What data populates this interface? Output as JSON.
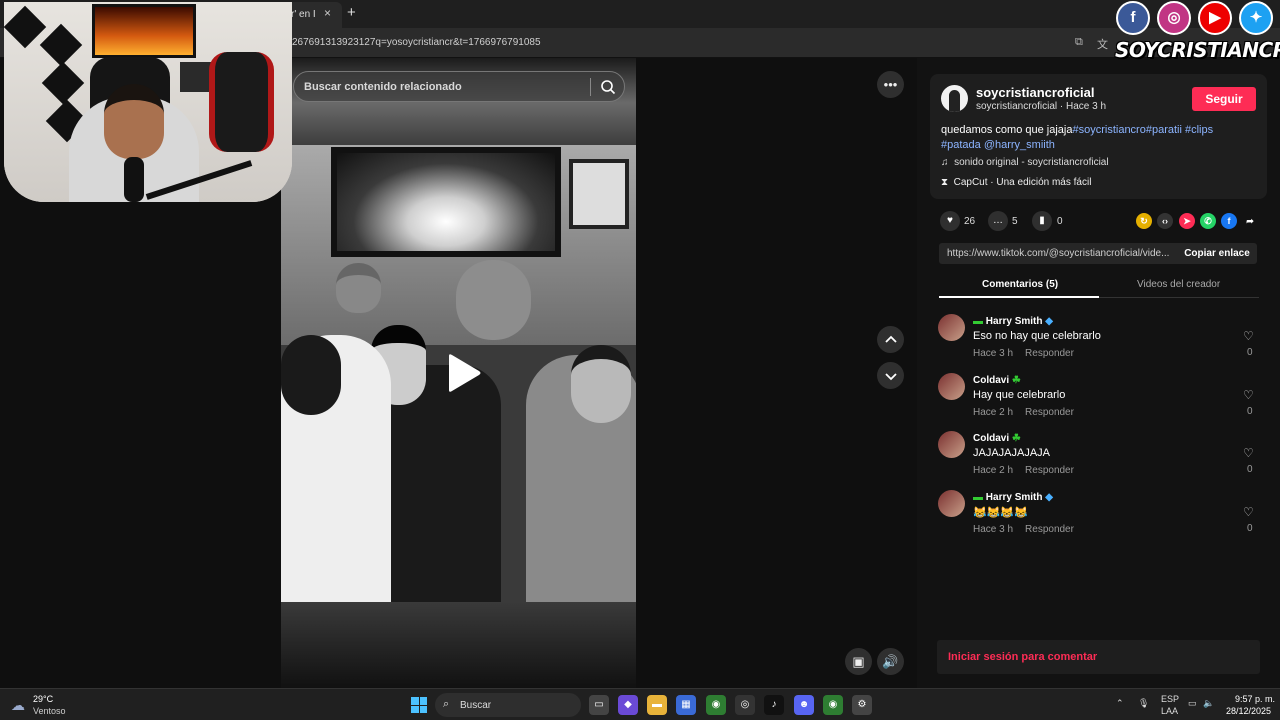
{
  "browser": {
    "tab_title": "cr' en I",
    "url": "267691313923127q=yosoycristiancr&t=1766976791085"
  },
  "video": {
    "search_placeholder": "Buscar contenido relacionado"
  },
  "post": {
    "author": "soycristiancroficial",
    "author_sub": "soycristiancroficial · Hace 3 h",
    "follow_label": "Seguir",
    "desc_text": "quedamos como que jajaja",
    "desc_tags": [
      "#soycristiancro",
      "#paratii",
      "#clips",
      "#patada",
      "@harry_smiith"
    ],
    "music": "sonido original - soycristiancroficial",
    "capcut": "CapCut · Una edición más fácil",
    "likes": "26",
    "comments": "5",
    "saves": "0",
    "link": "https://www.tiktok.com/@soycristiancroficial/vide...",
    "copy_label": "Copiar enlace",
    "tab_comments": "Comentarios (5)",
    "tab_creator": "Videos del creador"
  },
  "comments": [
    {
      "name": "Harry Smith",
      "text": "Eso no hay que celebrarlo",
      "time": "Hace 3 h",
      "reply": "Responder",
      "likes": "0"
    },
    {
      "name": "Coldavi",
      "text": "Hay que celebrarlo",
      "time": "Hace 2 h",
      "reply": "Responder",
      "likes": "0"
    },
    {
      "name": "Coldavi",
      "text": "JAJAJAJAJAJA",
      "time": "Hace 2 h",
      "reply": "Responder",
      "likes": "0"
    },
    {
      "name": "Harry Smith",
      "text": "😹😹😹😹",
      "time": "Hace 3 h",
      "reply": "Responder",
      "likes": "0"
    }
  ],
  "login_prompt": "Iniciar sesión para comentar",
  "overlay": {
    "brand": "SOYCRISTIANCR"
  },
  "taskbar": {
    "temp": "29°C",
    "weather": "Ventoso",
    "search": "Buscar",
    "lang1": "ESP",
    "lang2": "LAA",
    "time": "9:57 p. m.",
    "date": "28/12/2025"
  },
  "colors": {
    "accent": "#fe2c55",
    "tag": "#8cb4ff"
  }
}
